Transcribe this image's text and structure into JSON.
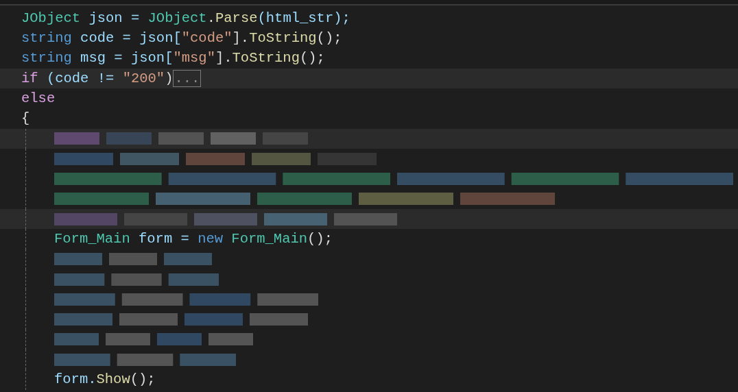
{
  "editor": {
    "lines": [
      {
        "kind": "code",
        "indent": false,
        "highlighted": false,
        "tokens": [
          {
            "text": "JObject",
            "kind": "type"
          },
          {
            "text": " json = ",
            "kind": "ident"
          },
          {
            "text": "JObject",
            "kind": "type"
          },
          {
            "text": ".",
            "kind": "plain"
          },
          {
            "text": "Parse",
            "kind": "method"
          },
          {
            "text": "(html_str);",
            "kind": "ident"
          }
        ]
      },
      {
        "kind": "code",
        "indent": false,
        "highlighted": false,
        "tokens": [
          {
            "text": "string",
            "kind": "keyword"
          },
          {
            "text": " code = json[",
            "kind": "ident"
          },
          {
            "text": "\"code\"",
            "kind": "string"
          },
          {
            "text": "].",
            "kind": "plain"
          },
          {
            "text": "ToString",
            "kind": "method"
          },
          {
            "text": "();",
            "kind": "plain"
          }
        ]
      },
      {
        "kind": "code",
        "indent": false,
        "highlighted": false,
        "tokens": [
          {
            "text": "string",
            "kind": "keyword"
          },
          {
            "text": " msg = json[",
            "kind": "ident"
          },
          {
            "text": "\"msg\"",
            "kind": "string"
          },
          {
            "text": "].",
            "kind": "plain"
          },
          {
            "text": "ToString",
            "kind": "method"
          },
          {
            "text": "();",
            "kind": "plain"
          }
        ]
      },
      {
        "kind": "code",
        "indent": false,
        "highlighted": true,
        "tokens": [
          {
            "text": "if",
            "kind": "control"
          },
          {
            "text": " (code != ",
            "kind": "ident"
          },
          {
            "text": "\"200\"",
            "kind": "string"
          },
          {
            "text": ")",
            "kind": "plain"
          },
          {
            "text": "...",
            "kind": "collapsed"
          }
        ]
      },
      {
        "kind": "code",
        "indent": false,
        "highlighted": false,
        "tokens": [
          {
            "text": "else",
            "kind": "control"
          }
        ]
      },
      {
        "kind": "code",
        "indent": false,
        "highlighted": false,
        "tokens": [
          {
            "text": "{",
            "kind": "plain"
          }
        ]
      },
      {
        "kind": "blurred",
        "indent": true,
        "highlighted": true
      },
      {
        "kind": "blurred",
        "indent": true,
        "highlighted": false
      },
      {
        "kind": "blurred",
        "indent": true,
        "highlighted": false
      },
      {
        "kind": "blurred",
        "indent": true,
        "highlighted": false
      },
      {
        "kind": "blurred",
        "indent": true,
        "highlighted": true
      },
      {
        "kind": "code",
        "indent": true,
        "highlighted": false,
        "tokens": [
          {
            "text": "Form_Main",
            "kind": "type"
          },
          {
            "text": " form = ",
            "kind": "ident"
          },
          {
            "text": "new",
            "kind": "keyword"
          },
          {
            "text": " Form_Main",
            "kind": "type"
          },
          {
            "text": "();",
            "kind": "plain"
          }
        ]
      },
      {
        "kind": "blurred",
        "indent": true,
        "highlighted": false
      },
      {
        "kind": "blurred",
        "indent": true,
        "highlighted": false
      },
      {
        "kind": "blurred",
        "indent": true,
        "highlighted": false
      },
      {
        "kind": "blurred",
        "indent": true,
        "highlighted": false
      },
      {
        "kind": "blurred",
        "indent": true,
        "highlighted": false
      },
      {
        "kind": "blurred",
        "indent": true,
        "highlighted": false
      },
      {
        "kind": "code",
        "indent": true,
        "highlighted": false,
        "tokens": [
          {
            "text": "form.",
            "kind": "ident"
          },
          {
            "text": "Show",
            "kind": "method"
          },
          {
            "text": "();",
            "kind": "plain"
          }
        ]
      }
    ]
  }
}
